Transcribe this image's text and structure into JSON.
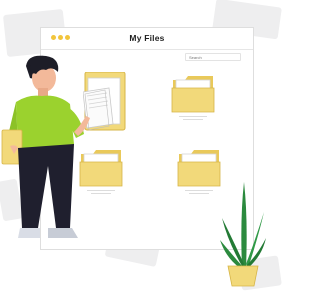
{
  "window": {
    "title": "My  Files",
    "controls": [
      "dot",
      "dot",
      "dot"
    ],
    "accent": "#f2c53c"
  },
  "search": {
    "placeholder": "Search"
  },
  "folders": [
    {
      "state": "open",
      "color": "#f2d97a"
    },
    {
      "state": "closed",
      "color": "#f2d97a"
    },
    {
      "state": "closed",
      "color": "#f2d97a"
    },
    {
      "state": "closed",
      "color": "#f2d97a"
    }
  ],
  "illustration": {
    "person_shirt": "#9bd22e",
    "person_pants": "#1f1f2e",
    "plant_leaves": "#2b8a3e",
    "plant_pot": "#f2d97a"
  },
  "icons": [
    "folder-icon",
    "open-folder-icon",
    "plant-icon",
    "person-figure"
  ]
}
